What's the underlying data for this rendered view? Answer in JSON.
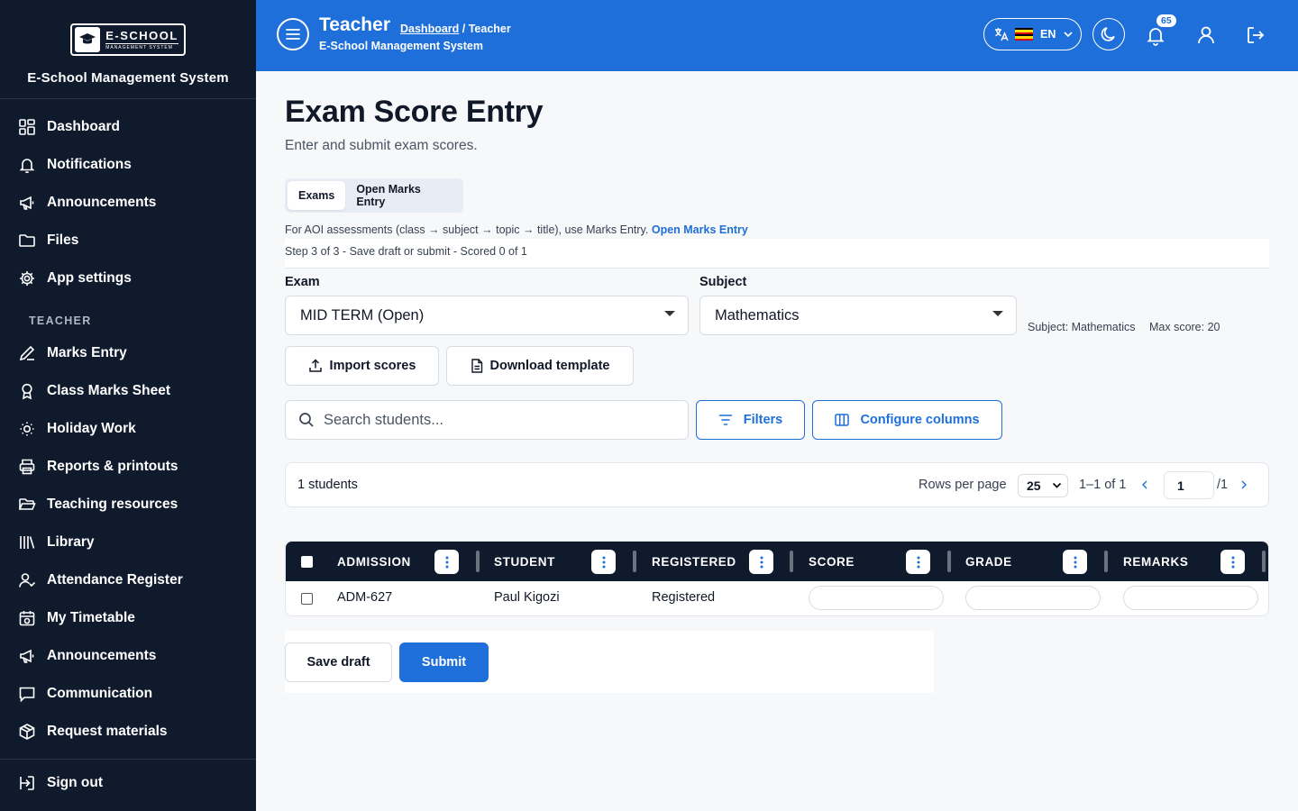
{
  "sidebar": {
    "logo_text": "E-SCHOOL",
    "logo_subtext": "MANAGEMENT SYSTEM",
    "system_name": "E-School Management System",
    "main_items": [
      {
        "label": "Dashboard",
        "icon": "dashboard-icon"
      },
      {
        "label": "Notifications",
        "icon": "bell-icon"
      },
      {
        "label": "Announcements",
        "icon": "megaphone-icon"
      },
      {
        "label": "Files",
        "icon": "folder-icon"
      },
      {
        "label": "App settings",
        "icon": "gear-icon"
      }
    ],
    "section_label": "TEACHER",
    "teacher_items": [
      {
        "label": "Marks Entry",
        "icon": "pencil-icon"
      },
      {
        "label": "Class Marks Sheet",
        "icon": "award-icon"
      },
      {
        "label": "Holiday Work",
        "icon": "sun-icon"
      },
      {
        "label": "Reports & printouts",
        "icon": "printer-icon"
      },
      {
        "label": "Teaching resources",
        "icon": "folder-open-icon"
      },
      {
        "label": "Library",
        "icon": "library-icon"
      },
      {
        "label": "Attendance Register",
        "icon": "user-check-icon"
      },
      {
        "label": "My Timetable",
        "icon": "calendar-icon"
      },
      {
        "label": "Announcements",
        "icon": "megaphone-icon"
      },
      {
        "label": "Communication",
        "icon": "message-icon"
      },
      {
        "label": "Request materials",
        "icon": "package-icon"
      }
    ],
    "sign_out": "Sign out"
  },
  "header": {
    "title": "Teacher",
    "breadcrumb_link": "Dashboard",
    "breadcrumb_current": "/ Teacher",
    "subtitle": "E-School Management System",
    "language": "EN",
    "notification_count": "65",
    "accent_color": "#1e6fd9"
  },
  "page": {
    "title": "Exam Score Entry",
    "subtitle": "Enter and submit exam scores.",
    "tabs": [
      "Exams",
      "Open Marks Entry"
    ],
    "active_tab": "Exams",
    "info_text": "For AOI assessments (class → subject → topic → title), use Marks Entry.",
    "info_link": "Open Marks Entry",
    "step_text": "Step 3 of 3 - Save draft or submit - Scored 0 of 1",
    "exam_label": "Exam",
    "exam_value": "MID TERM (Open)",
    "subject_label": "Subject",
    "subject_value": "Mathematics",
    "subject_meta": "Subject: Mathematics",
    "max_score": "Max score: 20",
    "import_button": "Import scores",
    "download_button": "Download template",
    "search_placeholder": "Search students...",
    "filters_button": "Filters",
    "configure_button": "Configure columns"
  },
  "pagination": {
    "count": "1 students",
    "rows_per_page_label": "Rows per page",
    "rows_per_page": "25",
    "range": "1–1 of 1",
    "page": "1",
    "total_pages": "/1"
  },
  "table": {
    "columns": [
      "ADMISSION",
      "STUDENT",
      "REGISTERED",
      "SCORE",
      "GRADE",
      "REMARKS"
    ],
    "rows": [
      {
        "admission": "ADM-627",
        "student": "Paul Kigozi",
        "registered": "Registered",
        "score": "",
        "grade": "",
        "remarks": ""
      }
    ]
  },
  "actions": {
    "save_draft": "Save draft",
    "submit": "Submit"
  }
}
